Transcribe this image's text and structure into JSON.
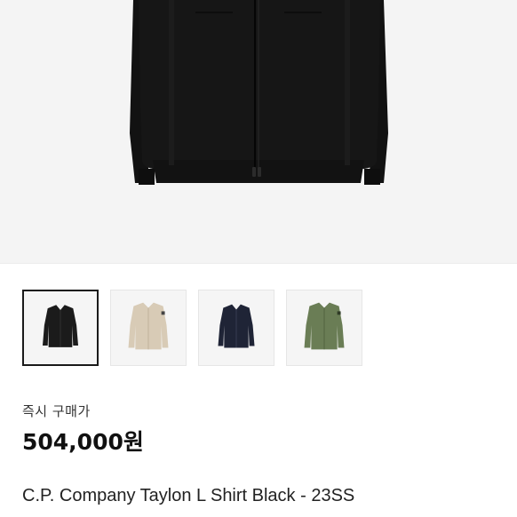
{
  "product": {
    "price_label": "즉시 구매가",
    "price": "504,000원",
    "title": "C.P. Company Taylon L Shirt Black - 23SS",
    "hero_image": "black-zip-shirt-jacket-image"
  },
  "thumbnails": [
    {
      "name": "black-jacket-thumbnail",
      "color": "#1b1b1b",
      "selected": true
    },
    {
      "name": "beige-jacket-thumbnail",
      "color": "#d8cbb6",
      "selected": false
    },
    {
      "name": "navy-jacket-thumbnail",
      "color": "#1f2436",
      "selected": false
    },
    {
      "name": "olive-jacket-thumbnail",
      "color": "#6a7d55",
      "selected": false
    }
  ]
}
